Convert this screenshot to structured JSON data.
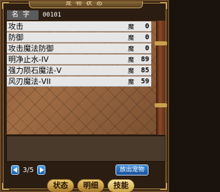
{
  "window": {
    "title": "宠物状态"
  },
  "name": {
    "label": "名字",
    "value": "00101"
  },
  "skills": [
    {
      "name": "攻击",
      "mp_label": "魔",
      "cost": "0"
    },
    {
      "name": "防御",
      "mp_label": "魔",
      "cost": "0"
    },
    {
      "name": "攻击魔法防御",
      "mp_label": "魔",
      "cost": "0"
    },
    {
      "name": "明净止水-IV",
      "mp_label": "魔",
      "cost": "89"
    },
    {
      "name": "强力陨石魔法-V",
      "mp_label": "魔",
      "cost": "85"
    },
    {
      "name": "风刃魔法-VII",
      "mp_label": "魔",
      "cost": "59"
    }
  ],
  "pager": {
    "text": "3/5"
  },
  "buttons": {
    "release": "放出宠物"
  },
  "tabs": [
    {
      "label": "状态"
    },
    {
      "label": "明细"
    },
    {
      "label": "技能"
    }
  ],
  "colors": {
    "row_bg": "#e6e6e6",
    "frame": "#6b4a24",
    "button_blue": "#2a6cc0"
  }
}
